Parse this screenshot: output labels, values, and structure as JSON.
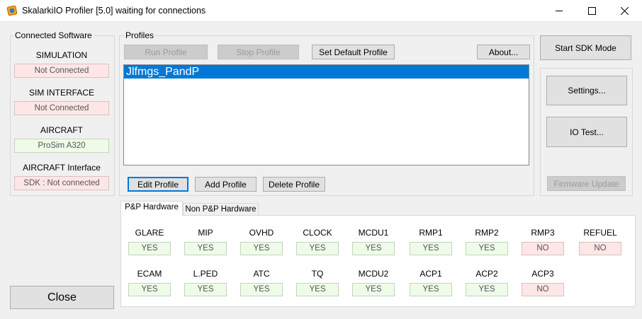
{
  "window": {
    "title": "SkalarkiIO Profiler [5.0] waiting for connections"
  },
  "connected": {
    "group_label": "Connected Software",
    "items": [
      {
        "label": "SIMULATION",
        "value": "Not Connected",
        "status": "bad"
      },
      {
        "label": "SIM INTERFACE",
        "value": "Not Connected",
        "status": "bad"
      },
      {
        "label": "AIRCRAFT",
        "value": "ProSim A320",
        "status": "good"
      },
      {
        "label": "AIRCRAFT Interface",
        "value": "SDK : Not connected",
        "status": "bad"
      }
    ],
    "close_label": "Close"
  },
  "profiles": {
    "group_label": "Profiles",
    "run_label": "Run Profile",
    "stop_label": "Stop Profile",
    "set_default_label": "Set Default Profile",
    "about_label": "About...",
    "list": [
      "Jlfmgs_PandP"
    ],
    "edit_label": "Edit Profile",
    "add_label": "Add Profile",
    "delete_label": "Delete Profile"
  },
  "right": {
    "start_sdk_label": "Start SDK Mode",
    "settings_label": "Settings...",
    "io_test_label": "IO Test...",
    "firmware_label": "Firmware Update"
  },
  "tabs": {
    "active": "P&P Hardware",
    "inactive": "Non P&P Hardware"
  },
  "hardware": {
    "row1": [
      {
        "name": "GLARE",
        "value": "YES"
      },
      {
        "name": "MIP",
        "value": "YES"
      },
      {
        "name": "OVHD",
        "value": "YES"
      },
      {
        "name": "CLOCK",
        "value": "YES"
      },
      {
        "name": "MCDU1",
        "value": "YES"
      },
      {
        "name": "RMP1",
        "value": "YES"
      },
      {
        "name": "RMP2",
        "value": "YES"
      },
      {
        "name": "RMP3",
        "value": "NO"
      },
      {
        "name": "REFUEL",
        "value": "NO"
      }
    ],
    "row2": [
      {
        "name": "ECAM",
        "value": "YES"
      },
      {
        "name": "L.PED",
        "value": "YES"
      },
      {
        "name": "ATC",
        "value": "YES"
      },
      {
        "name": "TQ",
        "value": "YES"
      },
      {
        "name": "MCDU2",
        "value": "YES"
      },
      {
        "name": "ACP1",
        "value": "YES"
      },
      {
        "name": "ACP2",
        "value": "YES"
      },
      {
        "name": "ACP3",
        "value": "NO"
      }
    ]
  },
  "colors": {
    "accent": "#0078d7",
    "status_yes_bg": "#eefbe9",
    "status_no_bg": "#ffe6e6"
  }
}
